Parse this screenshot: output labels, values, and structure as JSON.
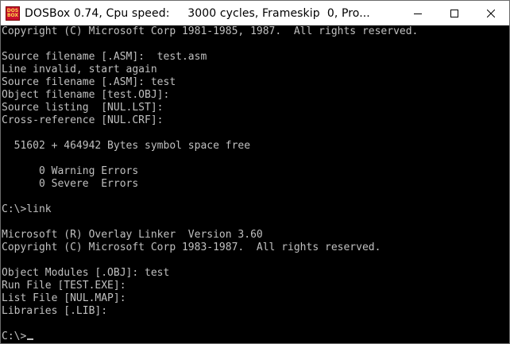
{
  "window": {
    "title": "DOSBox 0.74, Cpu speed:     3000 cycles, Frameskip  0, Pro...",
    "icon_text_top": "DOS",
    "icon_text_bottom": "BOX",
    "icons": {
      "app": "dosbox-icon",
      "minimize": "minimize-icon",
      "maximize": "maximize-icon",
      "close": "close-icon"
    }
  },
  "console": {
    "lines": [
      "Copyright (C) Microsoft Corp 1981-1985, 1987.  All rights reserved.",
      "",
      "Source filename [.ASM]:  test.asm",
      "Line invalid, start again",
      "Source filename [.ASM]: test",
      "Object filename [test.OBJ]:",
      "Source listing  [NUL.LST]:",
      "Cross-reference [NUL.CRF]:",
      "",
      "  51602 + 464942 Bytes symbol space free",
      "",
      "      0 Warning Errors",
      "      0 Severe  Errors",
      "",
      "C:\\>link",
      "",
      "Microsoft (R) Overlay Linker  Version 3.60",
      "Copyright (C) Microsoft Corp 1983-1987.  All rights reserved.",
      "",
      "Object Modules [.OBJ]: test",
      "Run File [TEST.EXE]:",
      "List File [NUL.MAP]:",
      "Libraries [.LIB]:",
      "",
      "C:\\>"
    ]
  },
  "colors": {
    "console_bg": "#000000",
    "console_fg": "#c0c0c0",
    "titlebar_bg": "#ffffff"
  }
}
